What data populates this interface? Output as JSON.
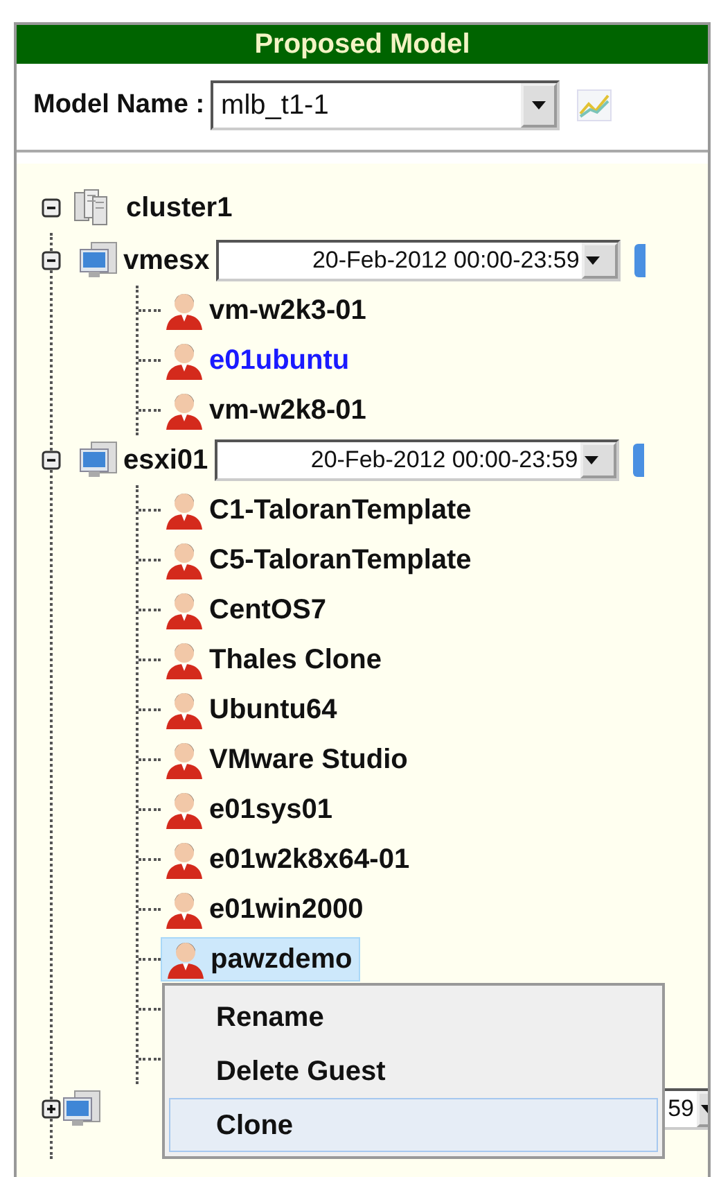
{
  "header": {
    "title": "Proposed Model"
  },
  "model": {
    "label": "Model Name :",
    "value": "mlb_t1-1"
  },
  "tree": {
    "name": "cluster1",
    "expanded": true,
    "children": [
      {
        "name": "vmesx",
        "expanded": true,
        "date_range": "20-Feb-2012 00:00-23:59",
        "children": [
          {
            "name": "vm-w2k3-01",
            "highlighted": false,
            "selected": false
          },
          {
            "name": "e01ubuntu",
            "highlighted": true,
            "selected": false
          },
          {
            "name": "vm-w2k8-01",
            "highlighted": false,
            "selected": false
          }
        ]
      },
      {
        "name": "esxi01",
        "expanded": true,
        "date_range": "20-Feb-2012 00:00-23:59",
        "children": [
          {
            "name": "C1-TaloranTemplate",
            "highlighted": false,
            "selected": false
          },
          {
            "name": "C5-TaloranTemplate",
            "highlighted": false,
            "selected": false
          },
          {
            "name": "CentOS7",
            "highlighted": false,
            "selected": false
          },
          {
            "name": "Thales Clone",
            "highlighted": false,
            "selected": false
          },
          {
            "name": "Ubuntu64",
            "highlighted": false,
            "selected": false
          },
          {
            "name": "VMware Studio",
            "highlighted": false,
            "selected": false
          },
          {
            "name": "e01sys01",
            "highlighted": false,
            "selected": false
          },
          {
            "name": "e01w2k8x64-01",
            "highlighted": false,
            "selected": false
          },
          {
            "name": "e01win2000",
            "highlighted": false,
            "selected": false
          },
          {
            "name": "pawzdemo",
            "highlighted": false,
            "selected": true
          }
        ]
      },
      {
        "expanded": false,
        "date_range": "59"
      }
    ]
  },
  "context_menu": {
    "items": [
      {
        "label": "Rename",
        "selected": false
      },
      {
        "label": "Delete Guest",
        "selected": false
      },
      {
        "label": "Clone",
        "selected": true
      }
    ]
  }
}
